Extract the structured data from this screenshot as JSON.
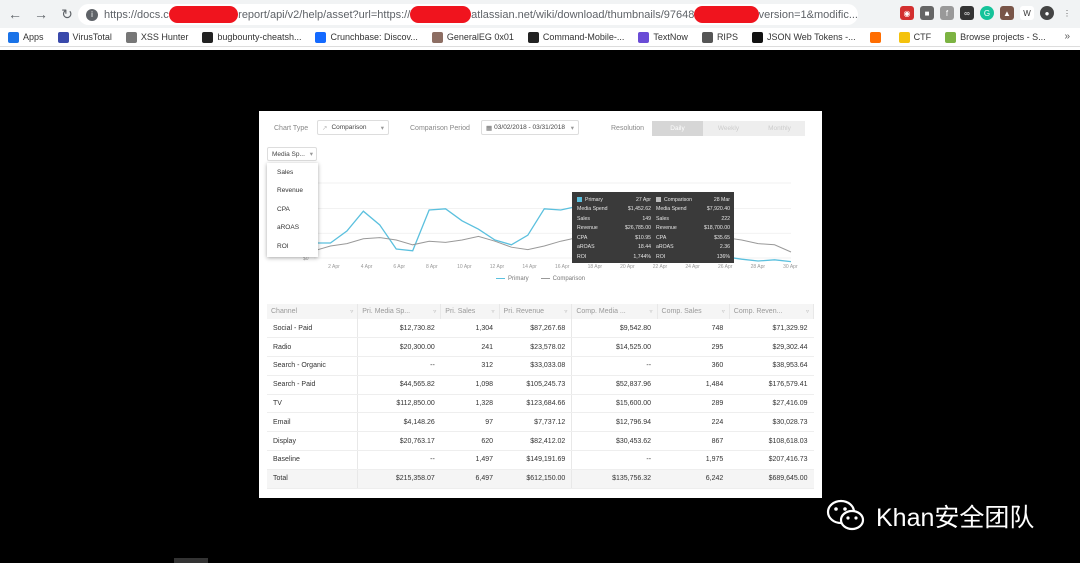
{
  "browser": {
    "url_segments": [
      "https://docs.c",
      "report/api/v2/help/asset?url=https://",
      "atlassian.net/wiki/download/thumbnails/97648",
      "version=1&modific..."
    ],
    "bookmarks": [
      {
        "label": "Apps",
        "icon": "apps-grid-icon",
        "color": "#1a73e8"
      },
      {
        "label": "VirusTotal",
        "icon": "virustotal-icon",
        "color": "#3949ab"
      },
      {
        "label": "XSS Hunter",
        "icon": "pen-icon",
        "color": "#777777"
      },
      {
        "label": "bugbounty-cheatsh...",
        "icon": "github-icon",
        "color": "#222222"
      },
      {
        "label": "Crunchbase: Discov...",
        "icon": "crunchbase-icon",
        "color": "#146aff"
      },
      {
        "label": "GeneralEG 0x01",
        "icon": "avatar-icon",
        "color": "#8d6e63"
      },
      {
        "label": "Command-Mobile-...",
        "icon": "github-icon",
        "color": "#222222"
      },
      {
        "label": "TextNow",
        "icon": "textnow-icon",
        "color": "#6a4cd6"
      },
      {
        "label": "RIPS",
        "icon": "rips-icon",
        "color": "#555555"
      },
      {
        "label": "JSON Web Tokens -...",
        "icon": "jwt-icon",
        "color": "#111111"
      },
      {
        "label": "",
        "icon": "orange-icon",
        "color": "#ff6d00"
      },
      {
        "label": "CTF",
        "icon": "folder-icon",
        "color": "#f4c20d"
      },
      {
        "label": "Browse projects - S...",
        "icon": "jira-icon",
        "color": "#7cb342"
      }
    ],
    "more_label": "»"
  },
  "controls": {
    "chart_type_label": "Chart Type",
    "chart_type_value": "Comparison",
    "comparison_period_label": "Comparison Period",
    "comparison_period_value": "03/02/2018 - 03/31/2018",
    "resolution_label": "Resolution",
    "resolution_options": [
      "Daily",
      "Weekly",
      "Monthly"
    ],
    "resolution_selected": "Daily"
  },
  "metric_select": {
    "value": "Media Sp...",
    "options": [
      "Sales",
      "Revenue",
      "CPA",
      "aROAS",
      "ROI"
    ]
  },
  "chart_data": {
    "type": "line",
    "x": [
      "2 Apr",
      "4 Apr",
      "6 Apr",
      "8 Apr",
      "10 Apr",
      "12 Apr",
      "14 Apr",
      "16 Apr",
      "18 Apr",
      "20 Apr",
      "22 Apr",
      "24 Apr",
      "26 Apr",
      "28 Apr",
      "30 Apr"
    ],
    "y_tick_label": "$0",
    "series": [
      {
        "name": "Primary",
        "color": "#5bc0de",
        "values": [
          0.25,
          0.25,
          0.45,
          0.78,
          0.55,
          0.15,
          0.12,
          0.8,
          0.82,
          0.62,
          0.48,
          0.3,
          0.22,
          0.38,
          0.82,
          0.8,
          0.86,
          0.88,
          0.6,
          0.42,
          0.28,
          0.12,
          0.05,
          0.02,
          0.04,
          0.02,
          -0.02,
          -0.05,
          -0.03,
          -0.06
        ]
      },
      {
        "name": "Comparison",
        "color": "#999999",
        "values": [
          0.12,
          0.2,
          0.24,
          0.32,
          0.34,
          0.3,
          0.22,
          0.28,
          0.26,
          0.3,
          0.36,
          0.28,
          0.18,
          0.14,
          0.2,
          0.28,
          0.34,
          0.36,
          0.4,
          0.46,
          0.48,
          0.44,
          0.42,
          0.36,
          0.38,
          0.34,
          0.3,
          0.24,
          0.22,
          0.1
        ]
      }
    ],
    "legend": [
      "Primary",
      "Comparison"
    ]
  },
  "tooltip": {
    "primary": {
      "title": "Primary",
      "date": "27 Apr",
      "color": "#5bc0de",
      "rows": [
        [
          "Media Spend",
          "$1,452.62"
        ],
        [
          "Sales",
          "149"
        ],
        [
          "Revenue",
          "$26,785.00"
        ],
        [
          "CPA",
          "$10.95"
        ],
        [
          "aROAS",
          "18.44"
        ],
        [
          "ROI",
          "1,744%"
        ]
      ]
    },
    "comparison": {
      "title": "Comparison",
      "date": "28 Mar",
      "color": "#bbbbbb",
      "rows": [
        [
          "Media Spend",
          "$7,920.40"
        ],
        [
          "Sales",
          "222"
        ],
        [
          "Revenue",
          "$18,700.00"
        ],
        [
          "CPA",
          "$35.65"
        ],
        [
          "aROAS",
          "2.36"
        ],
        [
          "ROI",
          "136%"
        ]
      ]
    }
  },
  "table": {
    "headers": [
      "Channel",
      "Pri. Media Sp...",
      "Pri. Sales",
      "Pri. Revenue",
      "Comp. Media ...",
      "Comp. Sales",
      "Comp. Reven..."
    ],
    "rows": [
      [
        "Social - Paid",
        "$12,730.82",
        "1,304",
        "$87,267.68",
        "$9,542.80",
        "748",
        "$71,329.92"
      ],
      [
        "Radio",
        "$20,300.00",
        "241",
        "$23,578.02",
        "$14,525.00",
        "295",
        "$29,302.44"
      ],
      [
        "Search - Organic",
        "--",
        "312",
        "$33,033.08",
        "--",
        "360",
        "$38,953.64"
      ],
      [
        "Search - Paid",
        "$44,565.82",
        "1,098",
        "$105,245.73",
        "$52,837.96",
        "1,484",
        "$176,579.41"
      ],
      [
        "TV",
        "$112,850.00",
        "1,328",
        "$123,684.66",
        "$15,600.00",
        "289",
        "$27,416.09"
      ],
      [
        "Email",
        "$4,148.26",
        "97",
        "$7,737.12",
        "$12,796.94",
        "224",
        "$30,028.73"
      ],
      [
        "Display",
        "$20,763.17",
        "620",
        "$82,412.02",
        "$30,453.62",
        "867",
        "$108,618.03"
      ],
      [
        "Baseline",
        "--",
        "1,497",
        "$149,191.69",
        "--",
        "1,975",
        "$207,416.73"
      ],
      [
        "Total",
        "$215,358.07",
        "6,497",
        "$612,150.00",
        "$135,756.32",
        "6,242",
        "$689,645.00"
      ]
    ]
  },
  "watermark": {
    "text": "Khan安全团队"
  }
}
